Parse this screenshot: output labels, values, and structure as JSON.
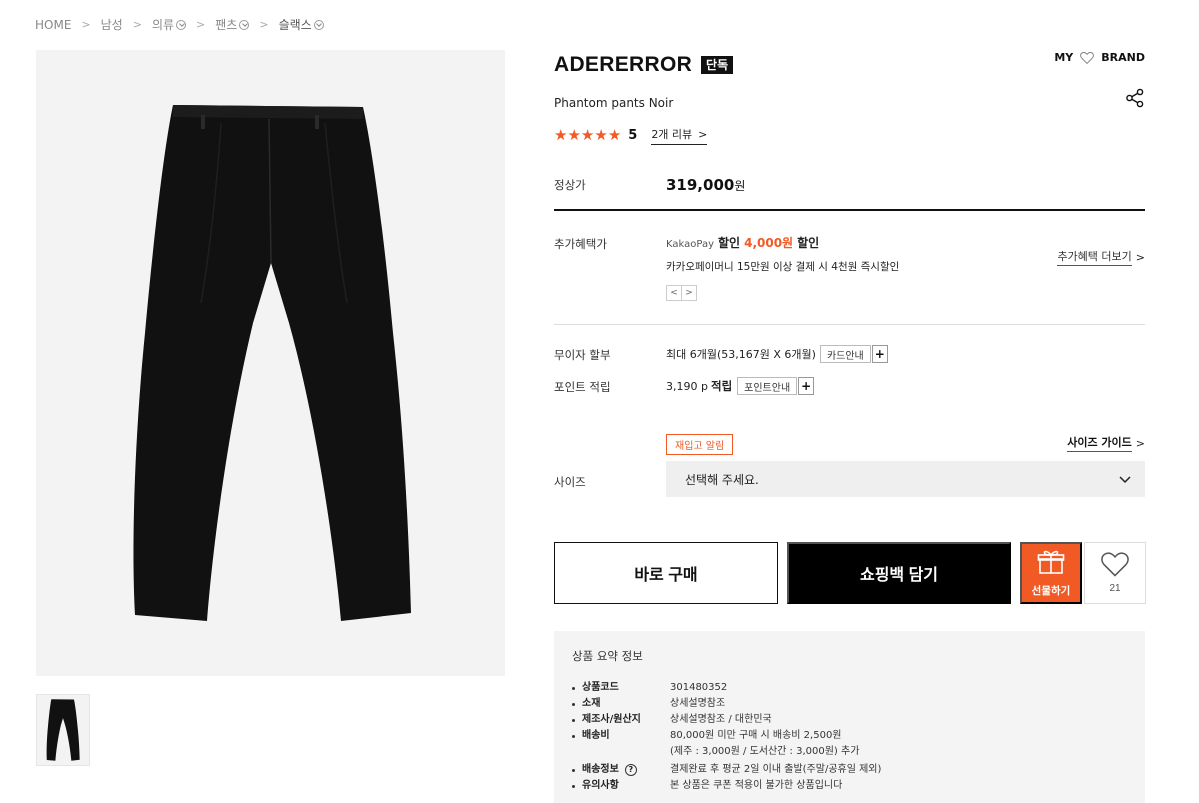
{
  "breadcrumb": [
    {
      "label": "HOME",
      "dropdown": false
    },
    {
      "label": "남성",
      "dropdown": false
    },
    {
      "label": "의류",
      "dropdown": true
    },
    {
      "label": "팬츠",
      "dropdown": true
    },
    {
      "label": "슬랙스",
      "dropdown": true
    }
  ],
  "product": {
    "brand": "ADERERROR",
    "exclusive_badge": "단독",
    "name": "Phantom pants Noir",
    "rating": "5",
    "review_link": "2개 리뷰",
    "image_color": "#111111"
  },
  "header_links": {
    "my": "MY",
    "brand": "BRAND"
  },
  "price": {
    "label": "정상가",
    "amount": "319,000",
    "unit": "원"
  },
  "benefit": {
    "label": "추가혜택가",
    "provider": "KakaoPay",
    "discount_prefix": "할인",
    "discount_amount": "4,000원",
    "discount_suffix": "할인",
    "note": "카카오페이머니 15만원 이상 결제 시 4천원 즉시할인",
    "more_link": "추가혜택 더보기"
  },
  "installment": {
    "label": "무이자 할부",
    "value": "최대 6개월(53,167원 X 6개월)",
    "button": "카드안내"
  },
  "points": {
    "label": "포인트 적립",
    "value": "3,190 p",
    "value_suffix": "적립",
    "button": "포인트안내"
  },
  "size": {
    "restock_label": "재입고 알림",
    "guide_link": "사이즈 가이드",
    "label": "사이즈",
    "placeholder": "선택해 주세요."
  },
  "actions": {
    "buy_now": "바로 구매",
    "add_to_cart": "쇼핑백 담기",
    "gift": "선물하기",
    "like_count": "21"
  },
  "summary": {
    "title": "상품 요약 정보",
    "rows": [
      {
        "key": "상품코드",
        "value": "301480352",
        "help": false
      },
      {
        "key": "소재",
        "value": "상세설명참조",
        "help": false
      },
      {
        "key": "제조사/원산지",
        "value": "상세설명참조 / 대한민국",
        "help": false
      },
      {
        "key": "배송비",
        "value": "80,000원 미만 구매 시 배송비 2,500원",
        "help": false
      },
      {
        "key": "",
        "value": "(제주 : 3,000원 / 도서산간 : 3,000원) 추가",
        "help": false
      },
      {
        "key": "배송정보",
        "value": "결제완료 후 평균 2일 이내 출발(주말/공휴일 제외)",
        "help": true
      },
      {
        "key": "유의사항",
        "value": "본 상품은 쿠폰 적용이 불가한 상품입니다",
        "help": false
      }
    ]
  },
  "colors": {
    "accent": "#f15a24",
    "primary": "#000000",
    "panel_bg": "#f4f4f4"
  }
}
